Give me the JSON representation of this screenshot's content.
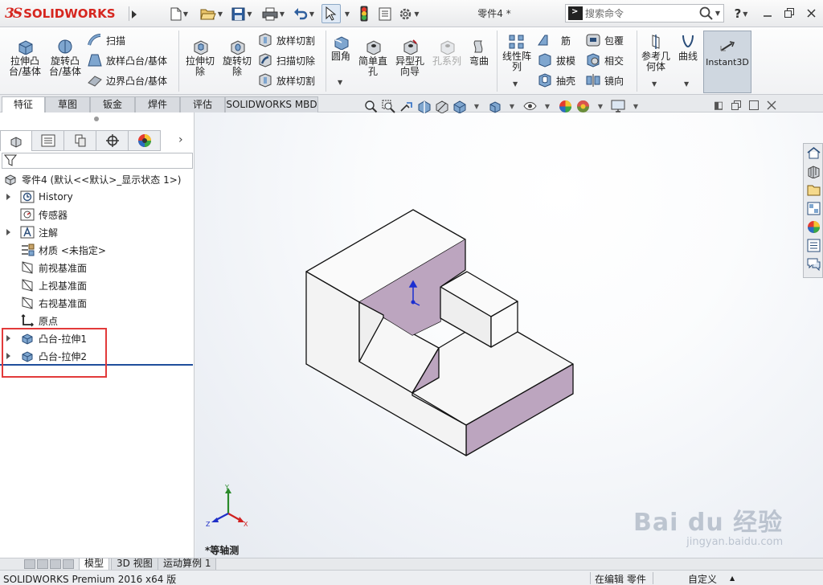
{
  "app": {
    "brand_mark": "3S",
    "brand_name": "SOLIDWORKS"
  },
  "title_bar": {
    "document_title": "零件4 *",
    "search_placeholder": "搜索命令",
    "help_label": "?"
  },
  "ribbon": {
    "extrude_boss": "拉伸凸\n台/基体",
    "revolve_boss": "旋转凸\n台/基体",
    "sweep": "扫描",
    "loft_boss": "放样凸台/基体",
    "boundary_boss": "边界凸台/基体",
    "extrude_cut": "拉伸切\n除",
    "revolve_cut": "旋转切\n除",
    "loft_cut_top": "放样切割",
    "sweep_cut": "扫描切除",
    "loft_cut_bottom": "放样切割",
    "fillet": "圆角",
    "simple_hole": "简单直\n孔",
    "hole_wizard": "异型孔\n向导",
    "hole_series": "孔系列",
    "wrap_feature": "弯曲",
    "linear_pattern": "线性阵\n列",
    "rib": "筋",
    "draft": "拔模",
    "shell": "抽壳",
    "wrap": "包覆",
    "intersect": "相交",
    "mirror": "镜向",
    "reference_geometry": "参考几\n何体",
    "curves": "曲线",
    "instant3d": "Instant3D"
  },
  "command_tabs": [
    {
      "label": "特征",
      "active": true
    },
    {
      "label": "草图",
      "active": false
    },
    {
      "label": "钣金",
      "active": false
    },
    {
      "label": "焊件",
      "active": false
    },
    {
      "label": "评估",
      "active": false
    },
    {
      "label": "SOLIDWORKS MBD",
      "active": false
    }
  ],
  "feature_tree": {
    "root": "零件4 (默认<<默认>_显示状态 1>)",
    "items": [
      {
        "label": "History",
        "icon": "history-icon",
        "expandable": true
      },
      {
        "label": "传感器",
        "icon": "sensor-icon",
        "expandable": false
      },
      {
        "label": "注解",
        "icon": "annotation-icon",
        "expandable": true
      },
      {
        "label": "材质 <未指定>",
        "icon": "material-icon",
        "expandable": false
      },
      {
        "label": "前视基准面",
        "icon": "plane-icon",
        "expandable": false
      },
      {
        "label": "上视基准面",
        "icon": "plane-icon",
        "expandable": false
      },
      {
        "label": "右视基准面",
        "icon": "plane-icon",
        "expandable": false
      },
      {
        "label": "原点",
        "icon": "origin-icon",
        "expandable": false
      },
      {
        "label": "凸台-拉伸1",
        "icon": "extrude-feature-icon",
        "expandable": true
      },
      {
        "label": "凸台-拉伸2",
        "icon": "extrude-feature-icon",
        "expandable": true
      }
    ]
  },
  "viewport": {
    "view_name": "*等轴测",
    "triad_x": "X",
    "triad_y": "Y",
    "triad_z": "Z",
    "watermark_main": "Bai du 经验",
    "watermark_url": "jingyan.baidu.com"
  },
  "bottom_tabs": [
    {
      "label": "模型",
      "active": true
    },
    {
      "label": "3D 视图",
      "active": false
    },
    {
      "label": "运动算例 1",
      "active": false
    }
  ],
  "status_bar": {
    "product": "SOLIDWORKS Premium 2016 x64 版",
    "mode": "在编辑 零件",
    "units": "自定义"
  },
  "colors": {
    "brand_red": "#d6261f",
    "highlight_box": "#e23a3a",
    "model_face_light": "#f5f5f5",
    "model_face_purple": "#bca5bf",
    "tree_end_bar": "#1f4e9c"
  }
}
